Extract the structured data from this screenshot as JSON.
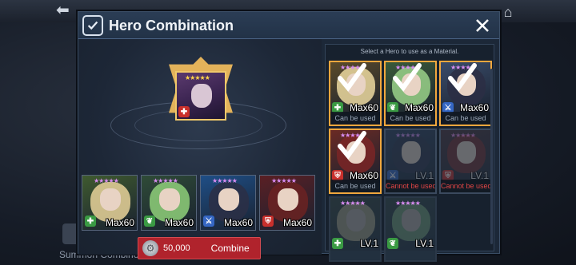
{
  "modal": {
    "title": "Hero Combination"
  },
  "target_hero": {
    "stars": "★★★★★",
    "class_icon": "cross-class-icon"
  },
  "combination_heroes": [
    {
      "stars": "★★★★★",
      "level": "Max60",
      "class_icon": "cross-class-icon",
      "badge": "green",
      "hair": "#e9d39a",
      "bg": "#3f5a2f"
    },
    {
      "stars": "★★★★★",
      "level": "Max60",
      "class_icon": "leaf-class-icon",
      "badge": "green",
      "hair": "#8fd07a",
      "bg": "#2f4b37"
    },
    {
      "stars": "★★★★★",
      "level": "Max60",
      "class_icon": "sword-class-icon",
      "badge": "blue",
      "hair": "#2c2f45",
      "bg": "#1e4e86"
    },
    {
      "stars": "★★★★★",
      "level": "Max60",
      "class_icon": "shield-class-icon",
      "badge": "red",
      "hair": "#6b2222",
      "bg": "#5a1f24"
    }
  ],
  "combine": {
    "cost": "50,000",
    "label": "Combine"
  },
  "material_panel": {
    "header": "Select a Hero to use as a Material.",
    "items": [
      {
        "level": "Max60",
        "status": "Can be used",
        "state": "selected",
        "badge": "green",
        "class_icon": "cross-class-icon",
        "hair": "#ecd9a0",
        "bg": "#5a4a2a"
      },
      {
        "level": "Max60",
        "status": "Can be used",
        "state": "selected",
        "badge": "green",
        "class_icon": "leaf-class-icon",
        "hair": "#9ad28a",
        "bg": "#3a5a3a"
      },
      {
        "level": "Max60",
        "status": "Can be used",
        "state": "selected",
        "badge": "blue",
        "class_icon": "sword-class-icon",
        "hair": "#2b2e44",
        "bg": "#3a4c6a"
      },
      {
        "level": "Max60",
        "status": "Can be used",
        "state": "selected",
        "badge": "red",
        "class_icon": "shield-class-icon",
        "hair": "#7a2626",
        "bg": "#6a2a24"
      },
      {
        "level": "LV.1",
        "status": "Cannot be used",
        "state": "disabled",
        "badge": "blue",
        "class_icon": "sword-class-icon",
        "hair": "#2b2e44",
        "bg": "#2a3a58"
      },
      {
        "level": "LV.1",
        "status": "Cannot be used",
        "state": "disabled",
        "badge": "red",
        "class_icon": "shield-class-icon",
        "hair": "#7a2626",
        "bg": "#4a2a30"
      },
      {
        "level": "LV.1",
        "status": "",
        "state": "empty",
        "badge": "green",
        "class_icon": "cross-class-icon",
        "hair": "#ecd9a0",
        "bg": "#33402e"
      },
      {
        "level": "LV.1",
        "status": "",
        "state": "empty",
        "badge": "green",
        "class_icon": "leaf-class-icon",
        "hair": "#9ad28a",
        "bg": "#2e3f36"
      }
    ]
  },
  "background": {
    "bottom_text": "Summon Combine     Piece"
  }
}
